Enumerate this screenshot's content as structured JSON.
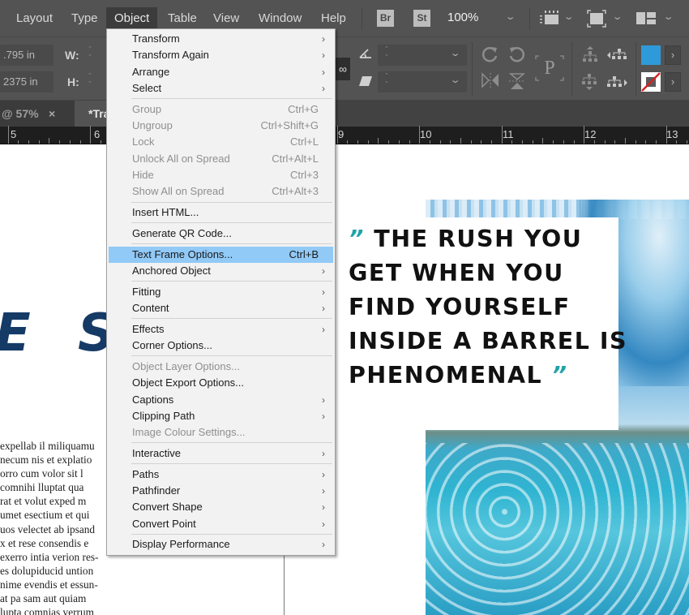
{
  "menubar": {
    "items": [
      {
        "label": "Layout",
        "active": false
      },
      {
        "label": "Type",
        "active": false
      },
      {
        "label": "Object",
        "active": true
      },
      {
        "label": "Table",
        "active": false
      },
      {
        "label": "View",
        "active": false
      },
      {
        "label": "Window",
        "active": false
      },
      {
        "label": "Help",
        "active": false
      }
    ],
    "bridge_label": "Br",
    "stock_label": "St",
    "zoom_level": "100%"
  },
  "control_panel": {
    "x_value": ".795 in",
    "y_value": "2375 in",
    "w_label": "W:",
    "h_label": "H:",
    "fill_color": "#2f9ad9",
    "stroke_color": "none"
  },
  "tabs": [
    {
      "label": "@ 57%",
      "active": false,
      "close": "×"
    },
    {
      "label": "*Tra",
      "active": true
    }
  ],
  "ruler": {
    "labels": [
      "5",
      "6",
      "9",
      "10",
      "11",
      "12",
      "13"
    ]
  },
  "object_menu": {
    "groups": [
      [
        {
          "label": "Transform",
          "submenu": true
        },
        {
          "label": "Transform Again",
          "submenu": true
        },
        {
          "label": "Arrange",
          "submenu": true
        },
        {
          "label": "Select",
          "submenu": true
        }
      ],
      [
        {
          "label": "Group",
          "shortcut": "Ctrl+G",
          "disabled": true
        },
        {
          "label": "Ungroup",
          "shortcut": "Ctrl+Shift+G",
          "disabled": true
        },
        {
          "label": "Lock",
          "shortcut": "Ctrl+L",
          "disabled": true
        },
        {
          "label": "Unlock All on Spread",
          "shortcut": "Ctrl+Alt+L",
          "disabled": true
        },
        {
          "label": "Hide",
          "shortcut": "Ctrl+3",
          "disabled": true
        },
        {
          "label": "Show All on Spread",
          "shortcut": "Ctrl+Alt+3",
          "disabled": true
        }
      ],
      [
        {
          "label": "Insert HTML..."
        }
      ],
      [
        {
          "label": "Generate QR Code..."
        }
      ],
      [
        {
          "label": "Text Frame Options...",
          "shortcut": "Ctrl+B",
          "highlighted": true
        },
        {
          "label": "Anchored Object",
          "submenu": true
        }
      ],
      [
        {
          "label": "Fitting",
          "submenu": true
        },
        {
          "label": "Content",
          "submenu": true
        }
      ],
      [
        {
          "label": "Effects",
          "submenu": true
        },
        {
          "label": "Corner Options..."
        }
      ],
      [
        {
          "label": "Object Layer Options...",
          "disabled": true
        },
        {
          "label": "Object Export Options..."
        },
        {
          "label": "Captions",
          "submenu": true
        },
        {
          "label": "Clipping Path",
          "submenu": true
        },
        {
          "label": "Image Colour Settings...",
          "disabled": true
        }
      ],
      [
        {
          "label": "Interactive",
          "submenu": true
        }
      ],
      [
        {
          "label": "Paths",
          "submenu": true
        },
        {
          "label": "Pathfinder",
          "submenu": true
        },
        {
          "label": "Convert Shape",
          "submenu": true
        },
        {
          "label": "Convert Point",
          "submenu": true
        }
      ],
      [
        {
          "label": "Display Performance",
          "submenu": true
        }
      ]
    ],
    "highlight_color": "#91c9f7"
  },
  "document": {
    "headline_fragment": "E S",
    "body_lines": [
      "expellab il miliquamu",
      "necum nis et explatio",
      "orro cum volor sit l",
      "comnihi lluptat qua",
      "rat et volut exped m",
      "umet esectium et qui",
      "uos velectet ab ipsand",
      "x et rese consendis e",
      "exerro intia verion res-",
      "es dolupiducid untion",
      "nime evendis et essun-",
      "at pa sam aut quiam",
      "lupta comnias verrum"
    ],
    "quote": {
      "open_mark": "”",
      "lines": [
        "THE RUSH YOU",
        "GET WHEN YOU",
        "FIND YOURSELF",
        "INSIDE A BARREL IS",
        "PHENOMENAL"
      ],
      "close_mark": "”",
      "accent_color": "#1ea3a8"
    }
  }
}
